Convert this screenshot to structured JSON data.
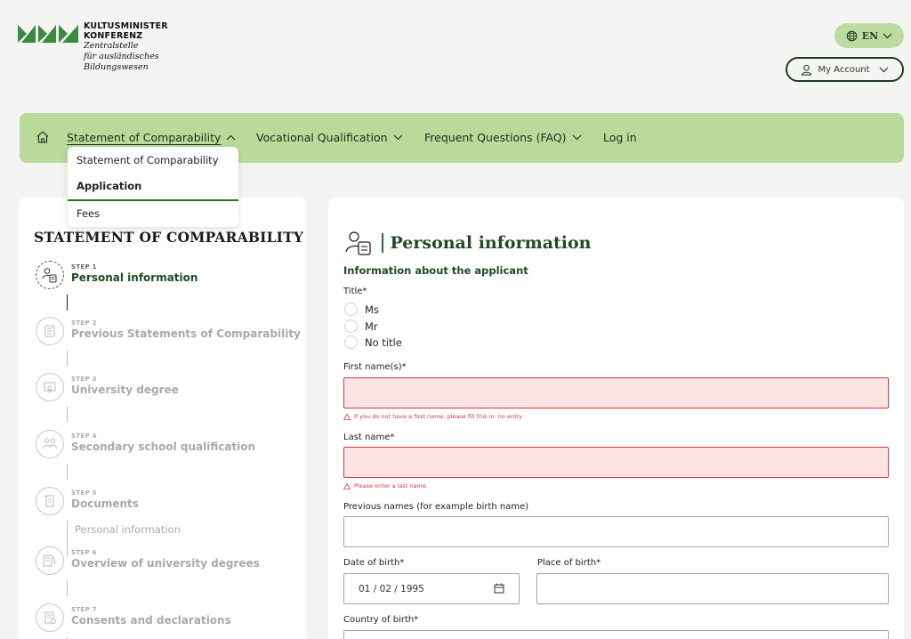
{
  "logo": {
    "line1": "KULTUSMINISTER",
    "line2": "KONFERENZ",
    "line3": "Zentralstelle",
    "line4": "für ausländisches",
    "line5": "Bildungswesen",
    "brand_color": "#3a8b3f"
  },
  "header": {
    "language": "EN",
    "account_label": "My Account"
  },
  "nav": {
    "home_icon": "home-icon",
    "items": [
      {
        "label": "Statement of Comparability",
        "active": true
      },
      {
        "label": "Vocational Qualification"
      },
      {
        "label": "Frequent Questions (FAQ)"
      },
      {
        "label": "Log in"
      }
    ],
    "dropdown": [
      "Statement of Comparability",
      "Application",
      "Fees"
    ],
    "dropdown_selected": "Application"
  },
  "sidebar": {
    "title": "STATEMENT OF COMPARABILITY",
    "steps": [
      {
        "num": "STEP 1",
        "name": "Personal information",
        "icon": "person-document-icon",
        "active": true
      },
      {
        "num": "STEP 2",
        "name": "Previous Statements of Comparability",
        "icon": "document-stack-icon"
      },
      {
        "num": "STEP 3",
        "name": "University degree",
        "icon": "certificate-icon"
      },
      {
        "num": "STEP 4",
        "name": "Secondary school qualification",
        "icon": "students-icon"
      },
      {
        "num": "STEP 5",
        "name": "Documents",
        "icon": "scroll-icon"
      },
      {
        "num": "STEP 6",
        "name": "Overview of university degrees",
        "icon": "overview-icon"
      },
      {
        "num": "STEP 7",
        "name": "Consents and declarations",
        "icon": "signed-document-icon"
      }
    ],
    "sub_step": "Personal information"
  },
  "form": {
    "title": "Personal information",
    "section": "Information about the applicant",
    "title_label": "Title*",
    "title_options": [
      "Ms",
      "Mr",
      "No title"
    ],
    "first_name_label": "First name(s)*",
    "first_name_error": "If you do not have a first name, please fill this in: no entry",
    "last_name_label": "Last name*",
    "last_name_error": "Please enter a last name.",
    "previous_names_label": "Previous names (for example birth name)",
    "dob_label": "Date of birth*",
    "dob_value": "01 / 02 / 1995",
    "place_label": "Place of birth*",
    "country_label": "Country of birth*",
    "accent": "#1f4a25",
    "error_color": "#d7373f"
  }
}
